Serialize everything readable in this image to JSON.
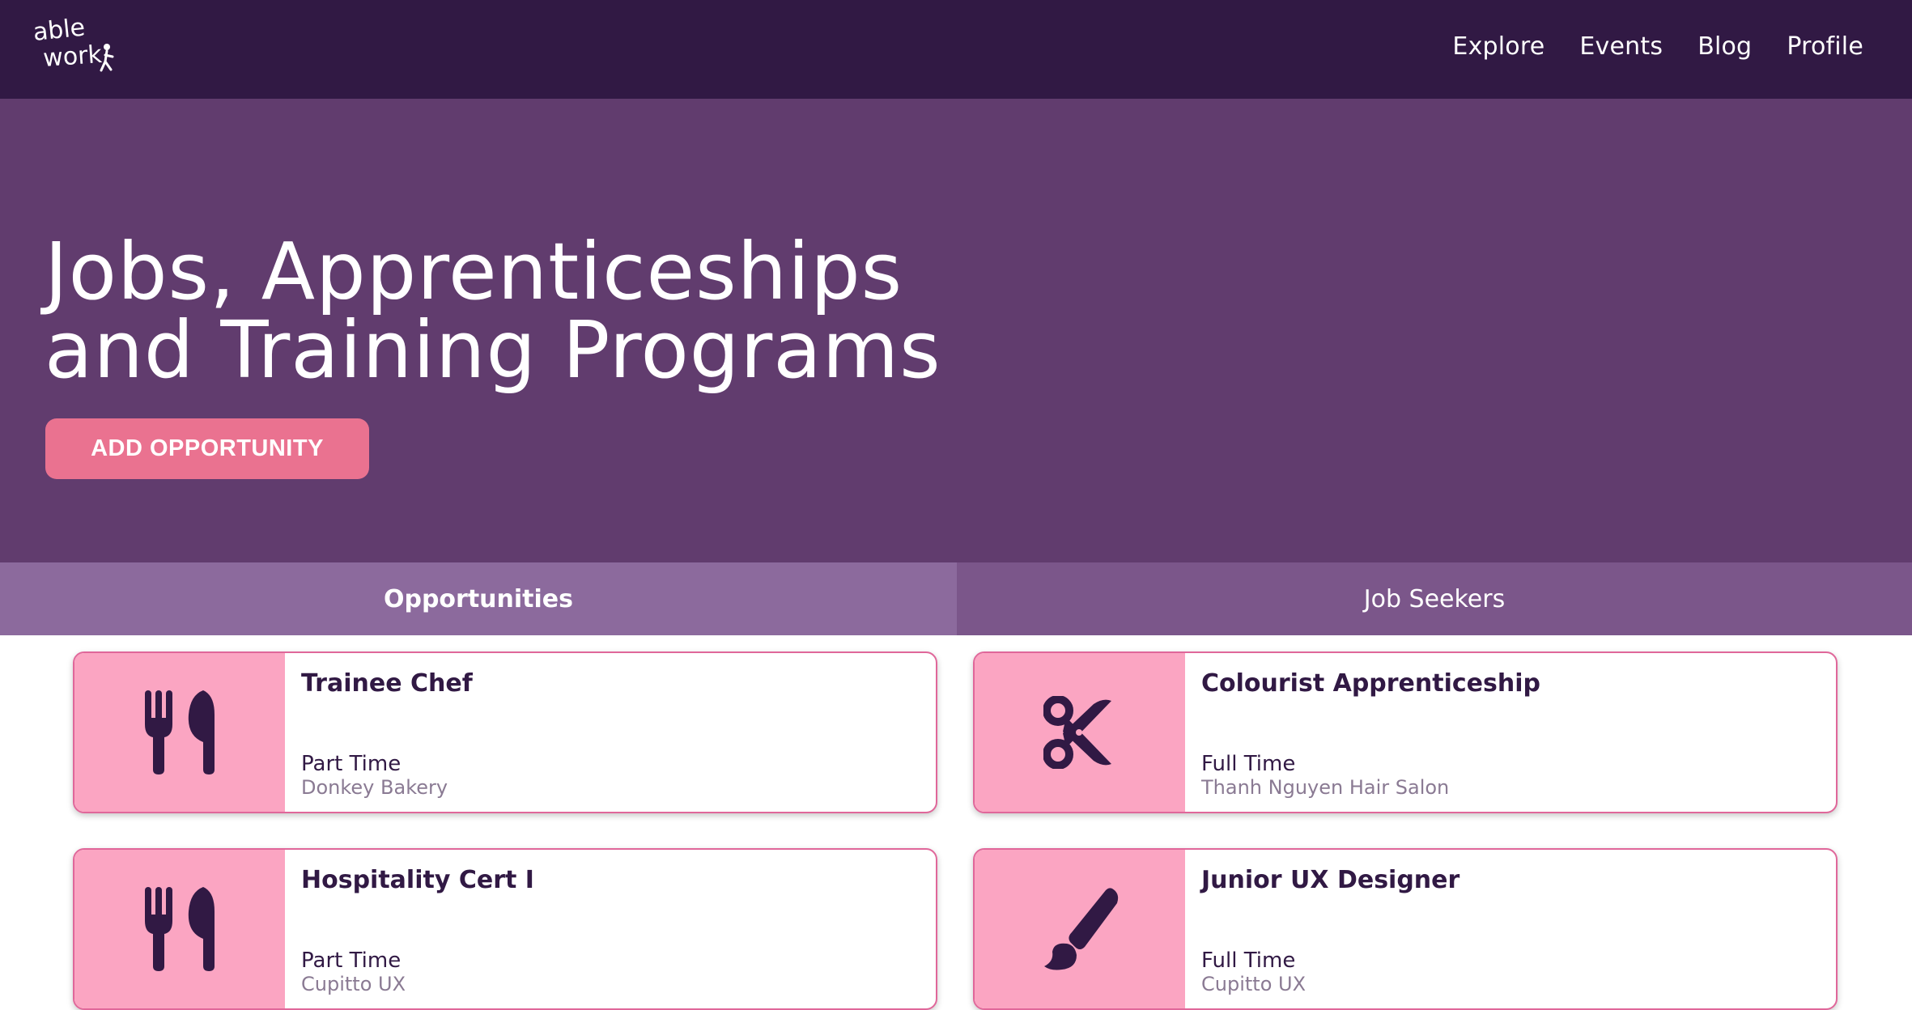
{
  "brand": {
    "logo_text_line1": "able",
    "logo_text_line2": "work"
  },
  "nav": {
    "items": [
      "Explore",
      "Events",
      "Blog",
      "Profile"
    ]
  },
  "hero": {
    "title_line1": "Jobs, Apprenticeships",
    "title_line2": "and Training Programs",
    "cta_label": "ADD OPPORTUNITY"
  },
  "tabs": {
    "opportunities": "Opportunities",
    "job_seekers": "Job Seekers"
  },
  "cards": [
    {
      "title": "Trainee Chef",
      "type": "Part Time",
      "company": "Donkey Bakery",
      "icon": "utensils-icon"
    },
    {
      "title": "Colourist Apprenticeship",
      "type": "Full Time",
      "company": "Thanh Nguyen Hair Salon",
      "icon": "scissors-icon"
    },
    {
      "title": "Hospitality Cert I",
      "type": "Part Time",
      "company": "Cupitto UX",
      "icon": "utensils-icon"
    },
    {
      "title": "Junior UX Designer",
      "type": "Full Time",
      "company": "Cupitto UX",
      "icon": "paintbrush-icon"
    }
  ],
  "colors": {
    "navbar": "#311944",
    "hero": "#613c6e",
    "accent": "#ea7290",
    "tab_active": "#8c6a9d",
    "tab_inactive": "#7b568a",
    "card_icon_bg": "#fba5c2",
    "card_border": "#e0679a"
  }
}
